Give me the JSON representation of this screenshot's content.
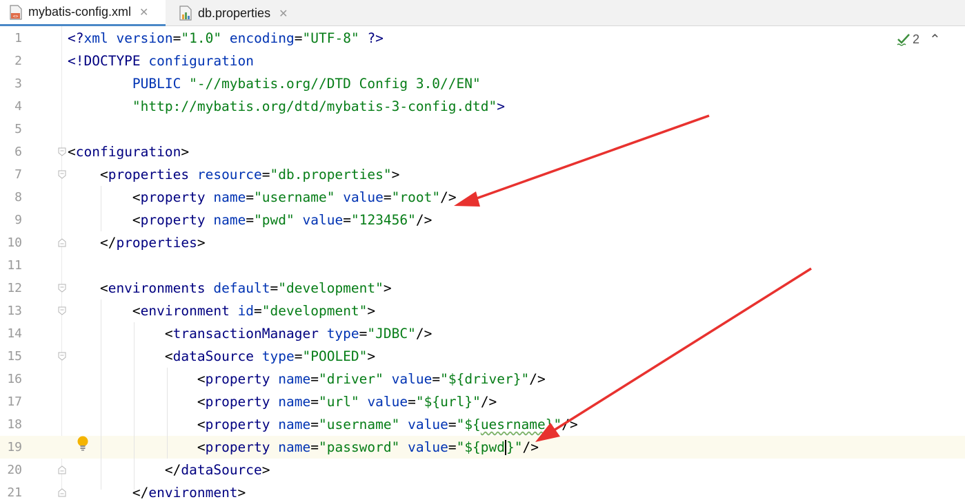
{
  "tabs": [
    {
      "label": "mybatis-config.xml",
      "active": true
    },
    {
      "label": "db.properties",
      "active": false
    }
  ],
  "tab_close_glyph": "✕",
  "inspection": {
    "count": "2",
    "up_glyph": "⌃"
  },
  "colors": {
    "tag": "#000080",
    "attr": "#0033b3",
    "string": "#067d17",
    "annotation_arrow": "#e8322f",
    "current_line": "#fcfaed"
  },
  "lines": [
    {
      "n": "1",
      "tokens": [
        [
          "tag",
          "<?"
        ],
        [
          "attr",
          "xml "
        ],
        [
          "attr",
          "version"
        ],
        [
          "plain",
          "="
        ],
        [
          "str",
          "\"1.0\" "
        ],
        [
          "attr",
          "encoding"
        ],
        [
          "plain",
          "="
        ],
        [
          "str",
          "\"UTF-8\" "
        ],
        [
          "tag",
          "?>"
        ]
      ]
    },
    {
      "n": "2",
      "tokens": [
        [
          "tag",
          "<!DOCTYPE "
        ],
        [
          "attr",
          "configuration"
        ]
      ]
    },
    {
      "n": "3",
      "tokens": [
        [
          "plain",
          "        "
        ],
        [
          "attr",
          "PUBLIC "
        ],
        [
          "str",
          "\"-//mybatis.org//DTD Config 3.0//EN\""
        ]
      ]
    },
    {
      "n": "4",
      "tokens": [
        [
          "plain",
          "        "
        ],
        [
          "str",
          "\"http://mybatis.org/dtd/mybatis-3-config.dtd\""
        ],
        [
          "tag",
          ">"
        ]
      ]
    },
    {
      "n": "5",
      "tokens": []
    },
    {
      "n": "6",
      "tokens": [
        [
          "plain",
          "<"
        ],
        [
          "tag",
          "configuration"
        ],
        [
          "plain",
          ">"
        ]
      ]
    },
    {
      "n": "7",
      "tokens": [
        [
          "plain",
          "    <"
        ],
        [
          "tag",
          "properties "
        ],
        [
          "attr",
          "resource"
        ],
        [
          "plain",
          "="
        ],
        [
          "str",
          "\"db.properties\""
        ],
        [
          "plain",
          ">"
        ]
      ]
    },
    {
      "n": "8",
      "tokens": [
        [
          "plain",
          "        <"
        ],
        [
          "tag",
          "property "
        ],
        [
          "attr",
          "name"
        ],
        [
          "plain",
          "="
        ],
        [
          "str",
          "\"username\" "
        ],
        [
          "attr",
          "value"
        ],
        [
          "plain",
          "="
        ],
        [
          "str",
          "\"root\""
        ],
        [
          "plain",
          "/>"
        ]
      ]
    },
    {
      "n": "9",
      "tokens": [
        [
          "plain",
          "        <"
        ],
        [
          "tag",
          "property "
        ],
        [
          "attr",
          "name"
        ],
        [
          "plain",
          "="
        ],
        [
          "str",
          "\"pwd\" "
        ],
        [
          "attr",
          "value"
        ],
        [
          "plain",
          "="
        ],
        [
          "str",
          "\"123456\""
        ],
        [
          "plain",
          "/>"
        ]
      ]
    },
    {
      "n": "10",
      "tokens": [
        [
          "plain",
          "    </"
        ],
        [
          "tag",
          "properties"
        ],
        [
          "plain",
          ">"
        ]
      ]
    },
    {
      "n": "11",
      "tokens": []
    },
    {
      "n": "12",
      "tokens": [
        [
          "plain",
          "    <"
        ],
        [
          "tag",
          "environments "
        ],
        [
          "attr",
          "default"
        ],
        [
          "plain",
          "="
        ],
        [
          "str",
          "\"development\""
        ],
        [
          "plain",
          ">"
        ]
      ]
    },
    {
      "n": "13",
      "tokens": [
        [
          "plain",
          "        <"
        ],
        [
          "tag",
          "environment "
        ],
        [
          "attr",
          "id"
        ],
        [
          "plain",
          "="
        ],
        [
          "str",
          "\"development\""
        ],
        [
          "plain",
          ">"
        ]
      ]
    },
    {
      "n": "14",
      "tokens": [
        [
          "plain",
          "            <"
        ],
        [
          "tag",
          "transactionManager "
        ],
        [
          "attr",
          "type"
        ],
        [
          "plain",
          "="
        ],
        [
          "str",
          "\"JDBC\""
        ],
        [
          "plain",
          "/>"
        ]
      ]
    },
    {
      "n": "15",
      "tokens": [
        [
          "plain",
          "            <"
        ],
        [
          "tag",
          "dataSource "
        ],
        [
          "attr",
          "type"
        ],
        [
          "plain",
          "="
        ],
        [
          "str",
          "\"POOLED\""
        ],
        [
          "plain",
          ">"
        ]
      ]
    },
    {
      "n": "16",
      "tokens": [
        [
          "plain",
          "                <"
        ],
        [
          "tag",
          "property "
        ],
        [
          "attr",
          "name"
        ],
        [
          "plain",
          "="
        ],
        [
          "str",
          "\"driver\" "
        ],
        [
          "attr",
          "value"
        ],
        [
          "plain",
          "="
        ],
        [
          "str",
          "\"${driver}\""
        ],
        [
          "plain",
          "/>"
        ]
      ]
    },
    {
      "n": "17",
      "tokens": [
        [
          "plain",
          "                <"
        ],
        [
          "tag",
          "property "
        ],
        [
          "attr",
          "name"
        ],
        [
          "plain",
          "="
        ],
        [
          "str",
          "\"url\" "
        ],
        [
          "attr",
          "value"
        ],
        [
          "plain",
          "="
        ],
        [
          "str",
          "\"${url}\""
        ],
        [
          "plain",
          "/>"
        ]
      ]
    },
    {
      "n": "18",
      "tokens": [
        [
          "plain",
          "                <"
        ],
        [
          "tag",
          "property "
        ],
        [
          "attr",
          "name"
        ],
        [
          "plain",
          "="
        ],
        [
          "str",
          "\"username\" "
        ],
        [
          "attr",
          "value"
        ],
        [
          "plain",
          "="
        ],
        [
          "str",
          "\"${"
        ],
        [
          "squig",
          "uesrname"
        ],
        [
          "str",
          "}\""
        ],
        [
          "plain",
          "/>"
        ]
      ]
    },
    {
      "n": "19",
      "tokens": [
        [
          "plain",
          "                <"
        ],
        [
          "tag",
          "property "
        ],
        [
          "attr",
          "name"
        ],
        [
          "plain",
          "="
        ],
        [
          "str",
          "\"password\" "
        ],
        [
          "attr",
          "value"
        ],
        [
          "plain",
          "="
        ],
        [
          "str",
          "\"${pwd"
        ],
        [
          "caret",
          ""
        ],
        [
          "str",
          "}\""
        ],
        [
          "plain",
          "/>"
        ]
      ],
      "current": true
    },
    {
      "n": "20",
      "tokens": [
        [
          "plain",
          "            </"
        ],
        [
          "tag",
          "dataSource"
        ],
        [
          "plain",
          ">"
        ]
      ]
    },
    {
      "n": "21",
      "tokens": [
        [
          "plain",
          "        </"
        ],
        [
          "tag",
          "environment"
        ],
        [
          "plain",
          ">"
        ]
      ]
    }
  ]
}
